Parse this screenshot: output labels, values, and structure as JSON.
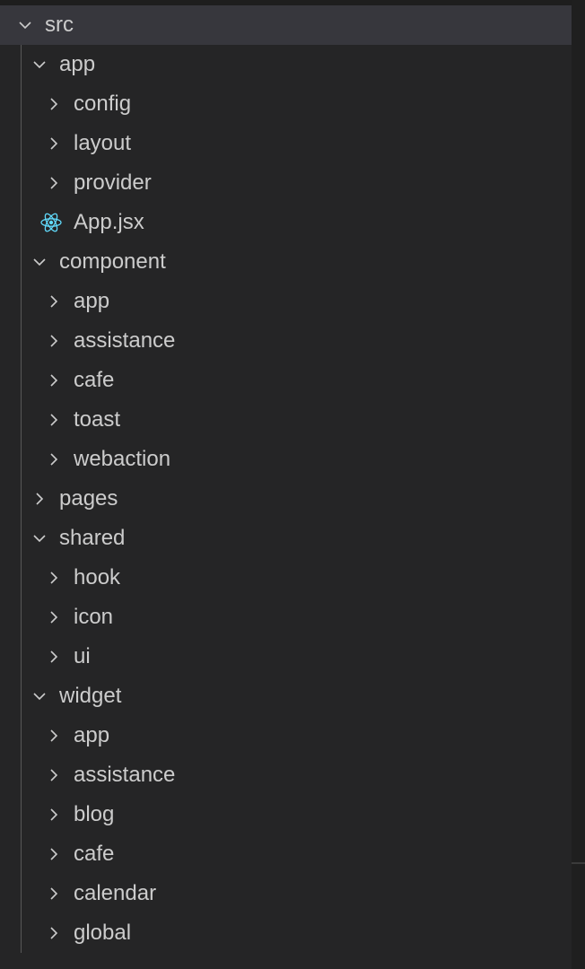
{
  "explorer": {
    "root": {
      "label": "src",
      "expanded": true
    },
    "app_folder": {
      "label": "app",
      "expanded": true
    },
    "app_children": [
      {
        "label": "config"
      },
      {
        "label": "layout"
      },
      {
        "label": "provider"
      }
    ],
    "app_file": {
      "label": "App.jsx",
      "icon": "react-icon"
    },
    "component_folder": {
      "label": "component",
      "expanded": true
    },
    "component_children": [
      {
        "label": "app"
      },
      {
        "label": "assistance"
      },
      {
        "label": "cafe"
      },
      {
        "label": "toast"
      },
      {
        "label": "webaction"
      }
    ],
    "pages_folder": {
      "label": "pages",
      "expanded": false
    },
    "shared_folder": {
      "label": "shared",
      "expanded": true
    },
    "shared_children": [
      {
        "label": "hook"
      },
      {
        "label": "icon"
      },
      {
        "label": "ui"
      }
    ],
    "widget_folder": {
      "label": "widget",
      "expanded": true
    },
    "widget_children": [
      {
        "label": "app"
      },
      {
        "label": "assistance"
      },
      {
        "label": "blog"
      },
      {
        "label": "cafe"
      },
      {
        "label": "calendar"
      },
      {
        "label": "global"
      }
    ]
  },
  "colors": {
    "background": "#252526",
    "selected_row": "#37373d",
    "text": "#cccccc",
    "react_icon": "#61dafb",
    "guide": "#585858"
  }
}
